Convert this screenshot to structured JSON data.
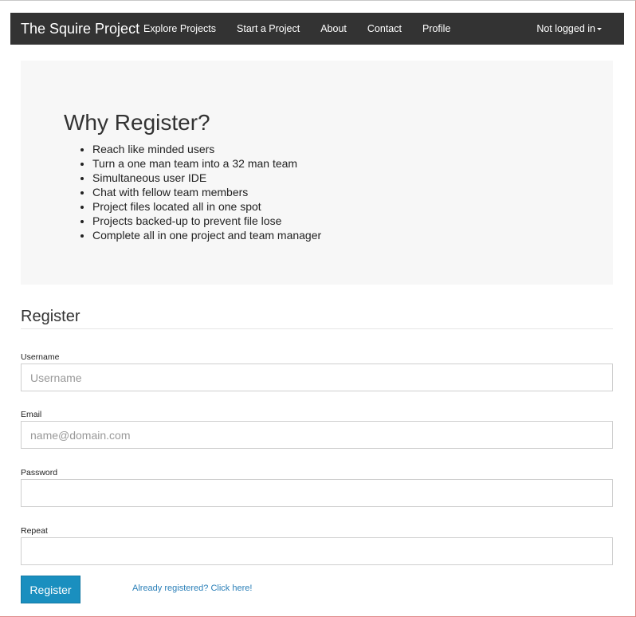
{
  "navbar": {
    "brand": "The Squire Project",
    "links": [
      "Explore Projects",
      "Start a Project",
      "About",
      "Contact",
      "Profile"
    ],
    "user_menu": "Not logged in"
  },
  "jumbotron": {
    "title": "Why Register?",
    "items": [
      "Reach like minded users",
      "Turn a one man team into a 32 man team",
      "Simultaneous user IDE",
      "Chat with fellow team members",
      "Project files located all in one spot",
      "Projects backed-up to prevent file lose",
      "Complete all in one project and team manager"
    ]
  },
  "register": {
    "title": "Register",
    "username": {
      "label": "Username",
      "placeholder": "Username"
    },
    "email": {
      "label": "Email",
      "placeholder": "name@domain.com"
    },
    "password": {
      "label": "Password",
      "placeholder": ""
    },
    "repeat": {
      "label": "Repeat",
      "placeholder": ""
    },
    "submit_label": "Register",
    "login_link": "Already registered? Click here!"
  },
  "colors": {
    "navbar_bg": "#333333",
    "jumbotron_bg": "#f7f7f7",
    "button_bg": "#1a8fbf",
    "link": "#2a7fb8"
  }
}
